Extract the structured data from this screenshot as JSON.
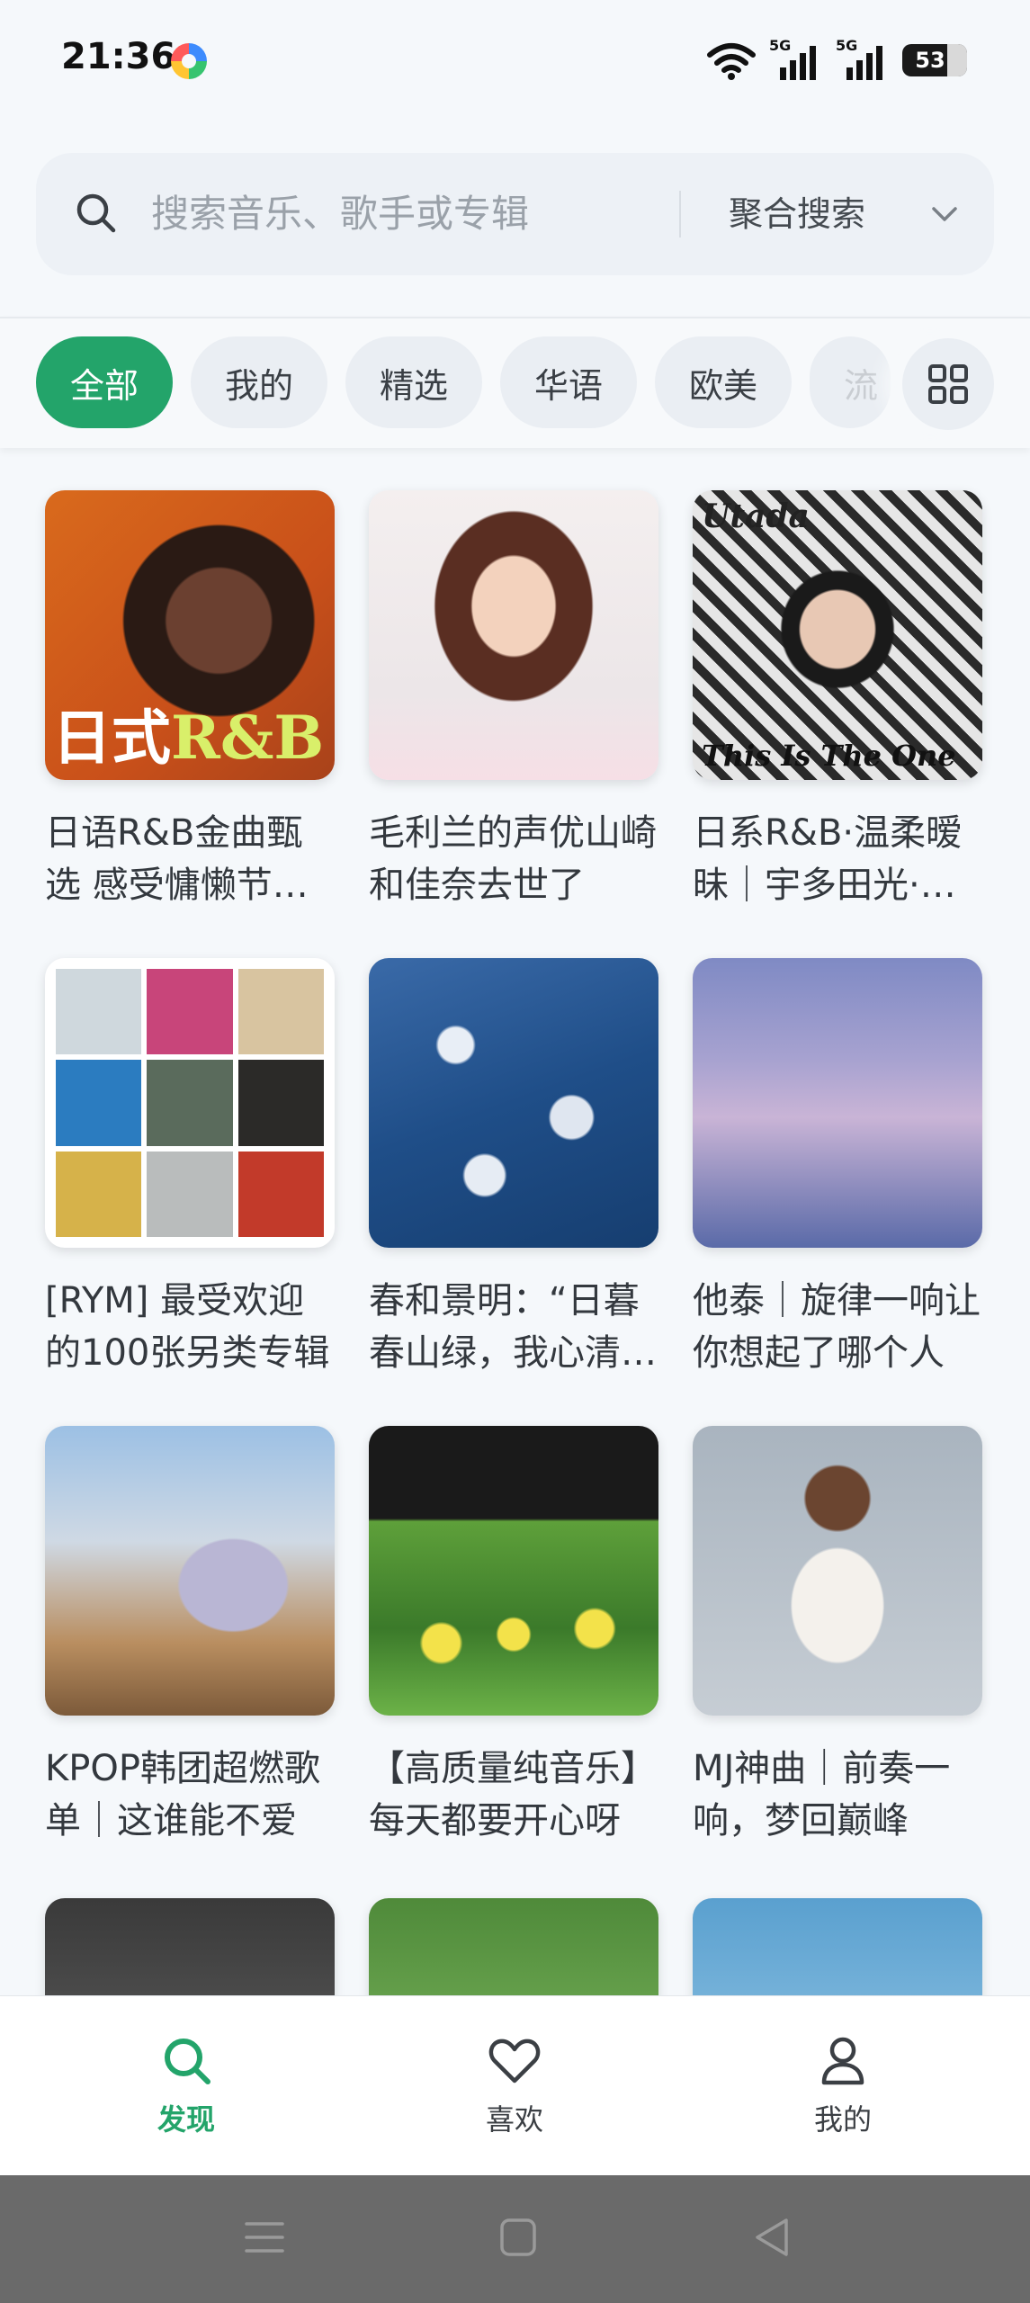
{
  "status_bar": {
    "time": "21:36",
    "signal_1_label": "5G",
    "signal_2_label": "5G",
    "battery": "53"
  },
  "search": {
    "placeholder": "搜索音乐、歌手或专辑",
    "mode_label": "聚合搜索"
  },
  "categories": [
    {
      "label": "全部",
      "active": true
    },
    {
      "label": "我的"
    },
    {
      "label": "精选"
    },
    {
      "label": "华语"
    },
    {
      "label": "欧美"
    },
    {
      "label": "流"
    }
  ],
  "playlists": [
    {
      "title": "日语R&B金曲甄选 感受慵懒节奏的魅力",
      "cover_text": "日式",
      "cover_text_accent": "R&B"
    },
    {
      "title": "毛利兰的声优山崎和佳奈去世了"
    },
    {
      "title": "日系R&B·温柔暧昧｜宇多田光·精选",
      "cover_text_top": "Utada",
      "cover_text_bottom": "This Is The One"
    },
    {
      "title": "[RYM] 最受欢迎的100张另类专辑"
    },
    {
      "title": "春和景明：“日暮春山绿，我心清且微”"
    },
    {
      "title": "他泰｜旋律一响让你想起了哪个人"
    },
    {
      "title": "KPOP韩团超燃歌单｜这谁能不爱"
    },
    {
      "title": "【高质量纯音乐】每天都要开心呀"
    },
    {
      "title": "MJ神曲｜前奏一响，梦回巅峰"
    },
    {
      "title": ""
    },
    {
      "title": ""
    },
    {
      "title": ""
    }
  ],
  "bottom_nav": [
    {
      "label": "发现",
      "icon": "search-icon",
      "active": true
    },
    {
      "label": "喜欢",
      "icon": "heart-icon"
    },
    {
      "label": "我的",
      "icon": "user-icon"
    }
  ],
  "colors": {
    "accent": "#23a46a",
    "background": "#f5f8fb"
  }
}
